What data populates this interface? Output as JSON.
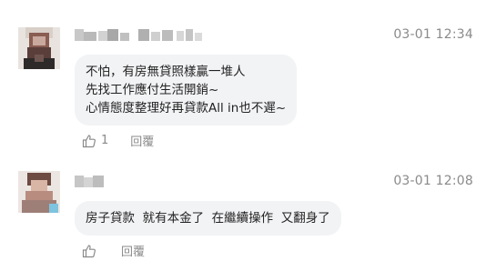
{
  "comments": [
    {
      "timestamp": "03-01 12:34",
      "lines": [
        "不怕，有房無貸照樣贏一堆人",
        "先找工作應付生活開銷~",
        "心情態度整理好再貸款All in也不遲~"
      ],
      "like_count": "1",
      "reply_label": "回覆",
      "like_icon": "thumbs-up-icon"
    },
    {
      "timestamp": "03-01 12:08",
      "lines": [
        "房子貸款  就有本金了  在繼續操作  又翻身了"
      ],
      "like_count": "",
      "reply_label": "回覆",
      "like_icon": "thumbs-up-icon"
    }
  ],
  "colors": {
    "bubble": "#f2f3f5",
    "muted_text": "#8a8a8a",
    "body_text": "#222222"
  }
}
